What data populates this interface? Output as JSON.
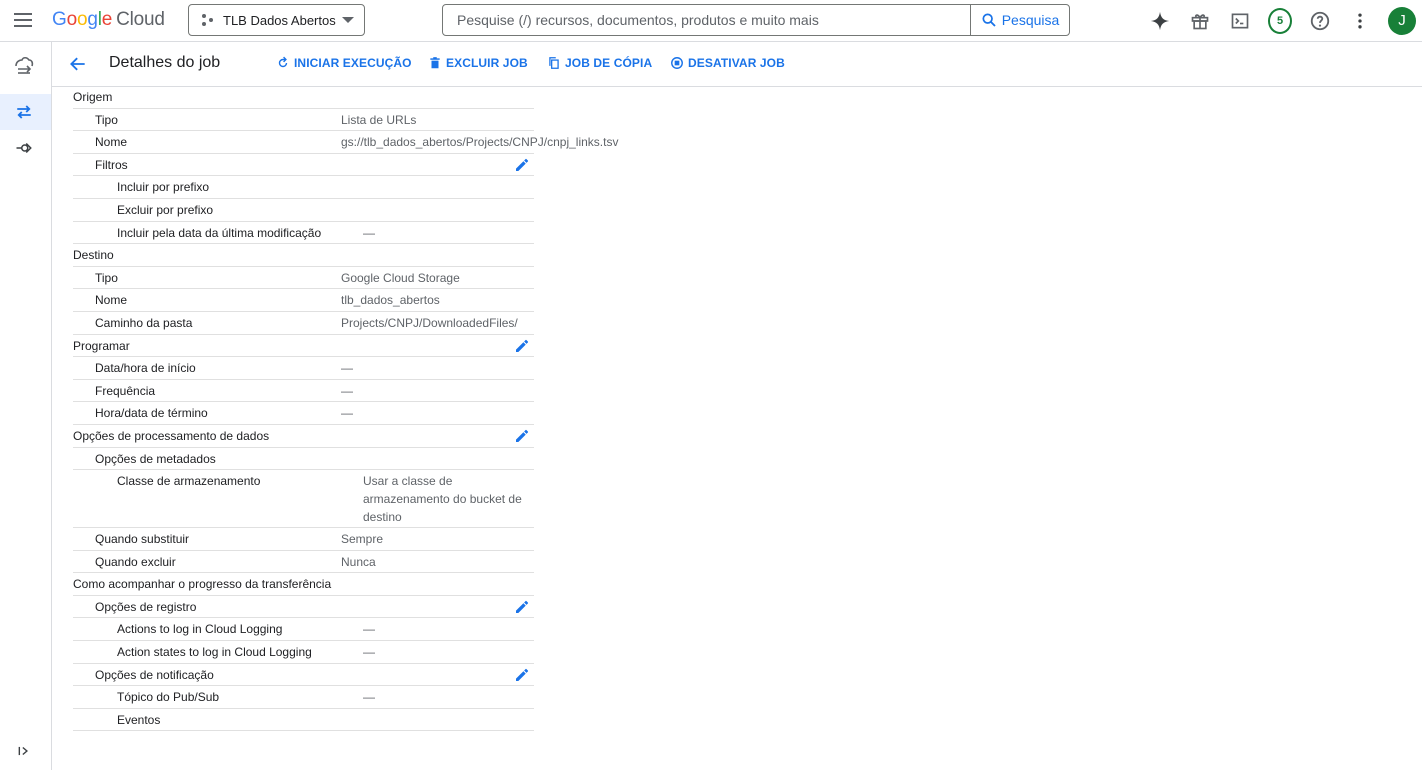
{
  "topbar": {
    "logo_letters": [
      "G",
      "o",
      "o",
      "g",
      "l",
      "e"
    ],
    "logo_cloud": "Cloud",
    "project_name": "TLB Dados Abertos",
    "search_placeholder": "Pesquise (/) recursos, documentos, produtos e muito mais",
    "search_button": "Pesquisa",
    "notification_count": "5",
    "avatar_letter": "J"
  },
  "header": {
    "title": "Detalhes do job",
    "actions": [
      "INICIAR EXECUÇÃO",
      "EXCLUIR JOB",
      "JOB DE CÓPIA",
      "DESATIVAR JOB"
    ]
  },
  "details": [
    {
      "label": "Origem",
      "value": "",
      "level": 0,
      "edit": false
    },
    {
      "label": "Tipo",
      "value": "Lista de URLs",
      "level": 1,
      "edit": false
    },
    {
      "label": "Nome",
      "value": "gs://tlb_dados_abertos/Projects/CNPJ/cnpj_links.tsv",
      "level": 1,
      "edit": false
    },
    {
      "label": "Filtros",
      "value": "",
      "level": 1,
      "edit": true
    },
    {
      "label": "Incluir por prefixo",
      "value": "",
      "level": 2,
      "edit": false
    },
    {
      "label": "Excluir por prefixo",
      "value": "",
      "level": 2,
      "edit": false
    },
    {
      "label": "Incluir pela data da última modificação",
      "value": "—",
      "level": 2,
      "edit": false
    },
    {
      "label": "Destino",
      "value": "",
      "level": 0,
      "edit": false
    },
    {
      "label": "Tipo",
      "value": "Google Cloud Storage",
      "level": 1,
      "edit": false
    },
    {
      "label": "Nome",
      "value": "tlb_dados_abertos",
      "level": 1,
      "edit": false
    },
    {
      "label": "Caminho da pasta",
      "value": " Projects/CNPJ/DownloadedFiles/",
      "level": 1,
      "edit": false
    },
    {
      "label": "Programar",
      "value": "",
      "level": 0,
      "edit": true
    },
    {
      "label": "Data/hora de início",
      "value": "—",
      "level": 1,
      "edit": false
    },
    {
      "label": "Frequência",
      "value": "—",
      "level": 1,
      "edit": false
    },
    {
      "label": "Hora/data de término",
      "value": "—",
      "level": 1,
      "edit": false
    },
    {
      "label": "Opções de processamento de dados",
      "value": "",
      "level": 0,
      "edit": true
    },
    {
      "label": "Opções de metadados",
      "value": "",
      "level": 1,
      "edit": false
    },
    {
      "label": "Classe de armazenamento",
      "value": "Usar a classe de armazenamento do bucket de destino",
      "level": 2,
      "edit": false,
      "tall": true
    },
    {
      "label": "Quando substituir",
      "value": "Sempre",
      "level": 1,
      "edit": false
    },
    {
      "label": "Quando excluir",
      "value": "Nunca",
      "level": 1,
      "edit": false
    },
    {
      "label": "Como acompanhar o progresso da transferência",
      "value": "",
      "level": 0,
      "edit": false
    },
    {
      "label": "Opções de registro",
      "value": "",
      "level": 1,
      "edit": true
    },
    {
      "label": "Actions to log in Cloud Logging",
      "value": "—",
      "level": 2,
      "edit": false
    },
    {
      "label": "Action states to log in Cloud Logging",
      "value": "—",
      "level": 2,
      "edit": false
    },
    {
      "label": "Opções de notificação",
      "value": "",
      "level": 1,
      "edit": true
    },
    {
      "label": "Tópico do Pub/Sub",
      "value": "—",
      "level": 2,
      "edit": false
    },
    {
      "label": "Eventos",
      "value": "",
      "level": 2,
      "edit": false
    }
  ]
}
